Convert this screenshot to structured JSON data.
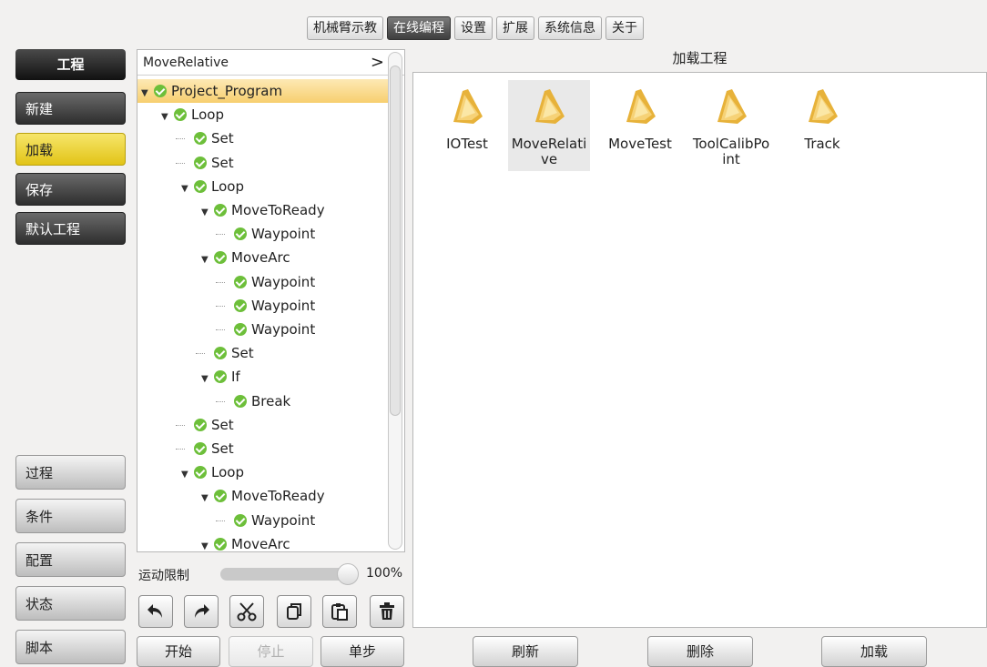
{
  "top_tabs": [
    {
      "label": "机械臂示教",
      "active": false
    },
    {
      "label": "在线编程",
      "active": true
    },
    {
      "label": "设置",
      "active": false
    },
    {
      "label": "扩展",
      "active": false
    },
    {
      "label": "系统信息",
      "active": false
    },
    {
      "label": "关于",
      "active": false
    }
  ],
  "sidebar": {
    "header": "工程",
    "top_items": [
      "新建",
      "加载",
      "保存",
      "默认工程"
    ],
    "active_item": "加载",
    "bottom_items": [
      "过程",
      "条件",
      "配置",
      "状态",
      "脚本"
    ]
  },
  "tree": {
    "header": "MoveRelative",
    "header_chevron": ">",
    "rows": [
      {
        "label": "Project_Program",
        "depth": 0,
        "expandable": true,
        "selected": true
      },
      {
        "label": "Loop",
        "depth": 1,
        "expandable": true
      },
      {
        "label": "Set",
        "depth": 2,
        "expandable": false
      },
      {
        "label": "Set",
        "depth": 2,
        "expandable": false
      },
      {
        "label": "Loop",
        "depth": 2,
        "expandable": true
      },
      {
        "label": "MoveToReady",
        "depth": 3,
        "expandable": true
      },
      {
        "label": "Waypoint",
        "depth": 4,
        "expandable": false
      },
      {
        "label": "MoveArc",
        "depth": 3,
        "expandable": true
      },
      {
        "label": "Waypoint",
        "depth": 4,
        "expandable": false
      },
      {
        "label": "Waypoint",
        "depth": 4,
        "expandable": false
      },
      {
        "label": "Waypoint",
        "depth": 4,
        "expandable": false
      },
      {
        "label": "Set",
        "depth": 3,
        "expandable": false
      },
      {
        "label": "If",
        "depth": 3,
        "expandable": true
      },
      {
        "label": "Break",
        "depth": 4,
        "expandable": false
      },
      {
        "label": "Set",
        "depth": 2,
        "expandable": false
      },
      {
        "label": "Set",
        "depth": 2,
        "expandable": false
      },
      {
        "label": "Loop",
        "depth": 2,
        "expandable": true
      },
      {
        "label": "MoveToReady",
        "depth": 3,
        "expandable": true
      },
      {
        "label": "Waypoint",
        "depth": 4,
        "expandable": false
      },
      {
        "label": "MoveArc",
        "depth": 3,
        "expandable": true
      }
    ]
  },
  "speed": {
    "label": "运动限制",
    "value_text": "100%",
    "fraction": 1.0
  },
  "toolbar": [
    "undo-icon",
    "redo-icon",
    "cut-icon",
    "copy-icon",
    "paste-icon",
    "delete-icon"
  ],
  "bottom_left": {
    "start": "开始",
    "stop": "停止",
    "step": "单步"
  },
  "right": {
    "title": "加载工程",
    "files": [
      {
        "name": "IOTest",
        "selected": false
      },
      {
        "name": "MoveRelative",
        "selected": true
      },
      {
        "name": "MoveTest",
        "selected": false
      },
      {
        "name": "ToolCalibPoint",
        "selected": false
      },
      {
        "name": "Track",
        "selected": false
      }
    ],
    "buttons": {
      "refresh": "刷新",
      "delete": "删除",
      "load": "加载"
    }
  },
  "colors": {
    "accent_yellow": "#e8cc2a",
    "check_green": "#6dbf3a",
    "selected_row": "#f7cf6f"
  }
}
